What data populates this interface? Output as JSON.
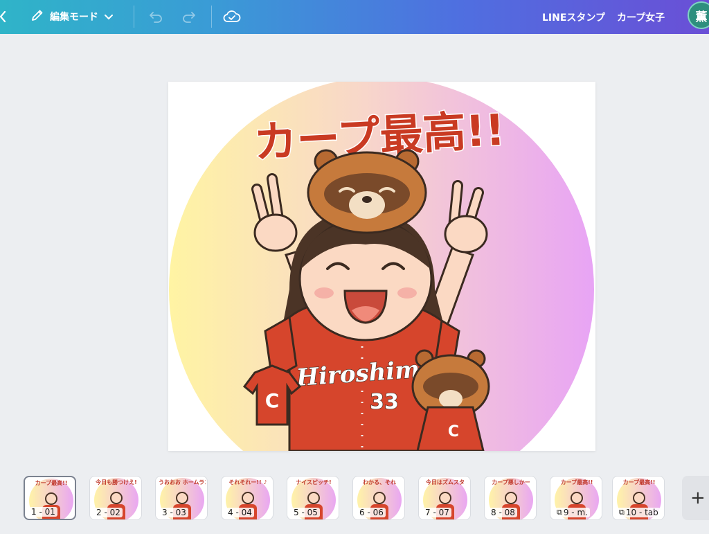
{
  "topbar": {
    "mode_label": "編集モード",
    "project_name": "LINEスタンプ",
    "design_name": "カープ女子",
    "avatar_initial": "薫",
    "gradient_start": "#2fb4c8",
    "gradient_end": "#6a4fd6"
  },
  "icons": {
    "back": "chevron-left-icon",
    "mode": "pencil-icon",
    "mode_dropdown": "chevron-down-icon",
    "undo": "undo-icon",
    "redo": "redo-icon",
    "save_status": "cloud-check-icon",
    "add_page": "plus-icon"
  },
  "canvas": {
    "headline": "カープ最高!!",
    "jersey_text": "Hiroshima",
    "jersey_number": "33",
    "logo_letter": "C",
    "headline_color": "#c93a22",
    "gradient_left": "#fff4a3",
    "gradient_right": "#e8a4f5"
  },
  "pages": [
    {
      "label": "1 - 01",
      "caption": "カープ最高!!",
      "active": true
    },
    {
      "label": "2 - 02",
      "caption": "今日も勝つけえ!"
    },
    {
      "label": "3 - 03",
      "caption": "うおおお ホームラン!!"
    },
    {
      "label": "4 - 04",
      "caption": "それそれー!! ♪"
    },
    {
      "label": "5 - 05",
      "caption": "ナイスピッチ!"
    },
    {
      "label": "6 - 06",
      "caption": "わかる、それ"
    },
    {
      "label": "7 - 07",
      "caption": "今日はズムスタ"
    },
    {
      "label": "8 - 08",
      "caption": "カープ悪しかー"
    },
    {
      "label": "9 - m.",
      "caption": "カープ最高!!",
      "icon": "template-icon"
    },
    {
      "label": "10 - tab",
      "caption": "カープ最高!!",
      "icon": "template-icon"
    }
  ]
}
